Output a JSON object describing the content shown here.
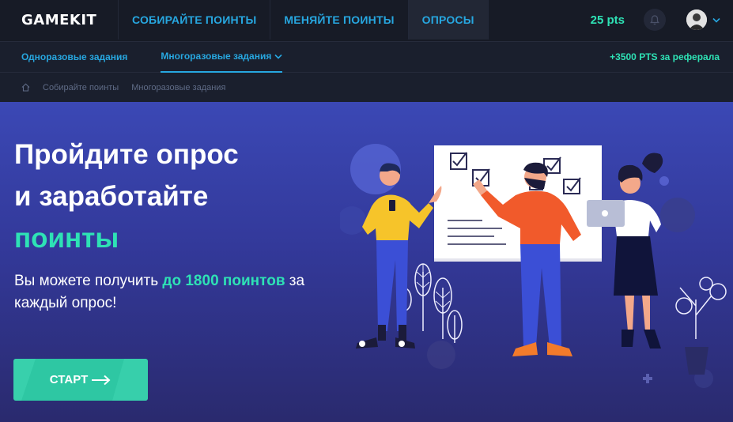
{
  "header": {
    "logo": "GAMEKIT",
    "nav": [
      {
        "label": "СОБИРАЙТЕ ПОИНТЫ"
      },
      {
        "label": "МЕНЯЙТЕ ПОИНТЫ"
      },
      {
        "label": "ОПРОСЫ"
      }
    ],
    "points": "25 pts",
    "icons": [
      "bell-icon",
      "avatar",
      "chevron-down-icon"
    ]
  },
  "subnav": {
    "items": [
      {
        "label": "Одноразовые задания"
      },
      {
        "label": "Многоразовые задания"
      }
    ],
    "referral": "+3500 PTS за реферала"
  },
  "breadcrumb": {
    "items": [
      "Собирайте поинты",
      "Многоразовые задания"
    ]
  },
  "hero": {
    "line1": "Пройдите опрос",
    "line2": "и заработайте",
    "line3": "поинты",
    "desc_before": "Вы можете получить ",
    "desc_highlight": "до 1800 поинтов",
    "desc_after": " за каждый опрос!",
    "button": "СТАРТ"
  },
  "colors": {
    "accent_blue": "#27a7e0",
    "accent_green": "#2ee2b5",
    "bg_dark": "#171b26",
    "hero_top": "#3b48b5"
  }
}
